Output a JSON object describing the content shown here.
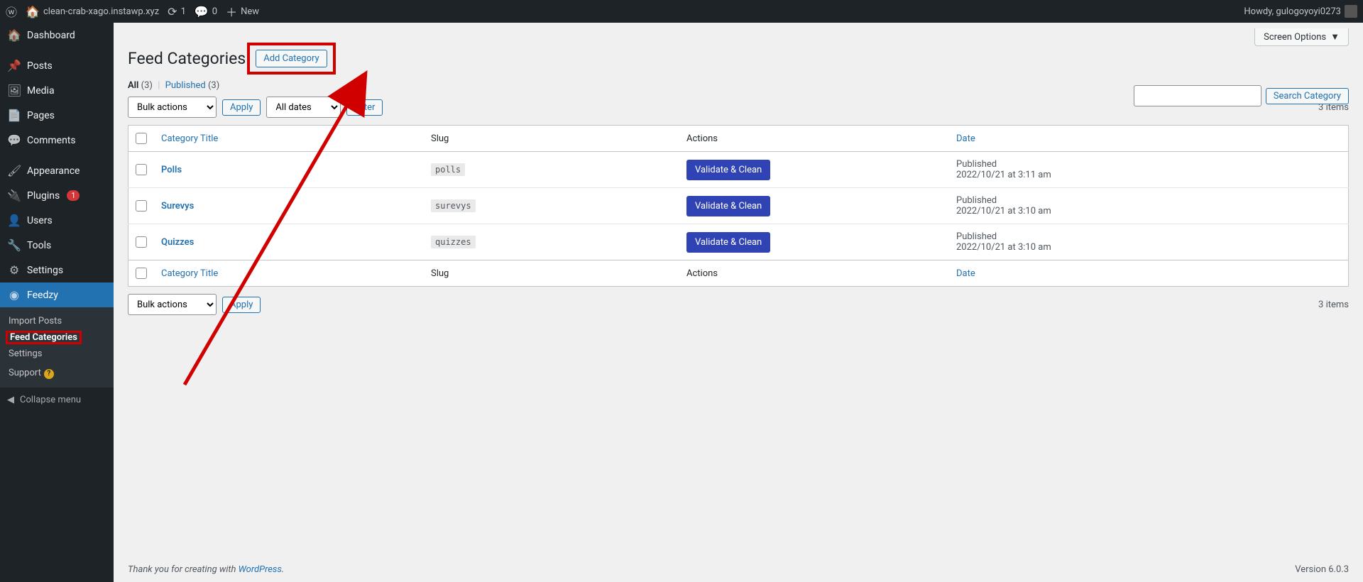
{
  "adminbar": {
    "site_name": "clean-crab-xago.instawp.xyz",
    "updates": "1",
    "comments": "0",
    "new_label": "New",
    "howdy": "Howdy, gulogoyoyi0273"
  },
  "sidebar": {
    "items": [
      {
        "icon": "◉",
        "label": "Dashboard"
      },
      {
        "icon": "✎",
        "label": "Posts"
      },
      {
        "icon": "🖼",
        "label": "Media"
      },
      {
        "icon": "▤",
        "label": "Pages"
      },
      {
        "icon": "💬",
        "label": "Comments"
      },
      {
        "icon": "🖌",
        "label": "Appearance"
      },
      {
        "icon": "🔌",
        "label": "Plugins",
        "badge": "1"
      },
      {
        "icon": "👤",
        "label": "Users"
      },
      {
        "icon": "🔧",
        "label": "Tools"
      },
      {
        "icon": "⚙",
        "label": "Settings"
      },
      {
        "icon": "📶",
        "label": "Feedzy"
      }
    ],
    "submenu": [
      {
        "label": "Import Posts"
      },
      {
        "label": "Feed Categories"
      },
      {
        "label": "Settings"
      },
      {
        "label": "Support",
        "help": "?"
      }
    ],
    "collapse": "Collapse menu"
  },
  "page": {
    "title": "Feed Categories",
    "add_category": "Add Category",
    "screen_options": "Screen Options"
  },
  "filters": {
    "all_label": "All",
    "all_count": "(3)",
    "published_label": "Published",
    "published_count": "(3)",
    "bulk_actions": "Bulk actions",
    "apply": "Apply",
    "all_dates": "All dates",
    "filter": "Filter",
    "items_count": "3 items",
    "search_button": "Search Category"
  },
  "table": {
    "headers": {
      "title": "Category Title",
      "slug": "Slug",
      "actions": "Actions",
      "date": "Date"
    },
    "validate_label": "Validate & Clean",
    "published_label": "Published",
    "rows": [
      {
        "title": "Polls",
        "slug": "polls",
        "date": "2022/10/21 at 3:11 am"
      },
      {
        "title": "Surevys",
        "slug": "surevys",
        "date": "2022/10/21 at 3:10 am"
      },
      {
        "title": "Quizzes",
        "slug": "quizzes",
        "date": "2022/10/21 at 3:10 am"
      }
    ]
  },
  "footer": {
    "thank_you_pre": "Thank you for creating with ",
    "wp_link": "WordPress",
    "thank_you_post": ".",
    "version": "Version 6.0.3"
  }
}
